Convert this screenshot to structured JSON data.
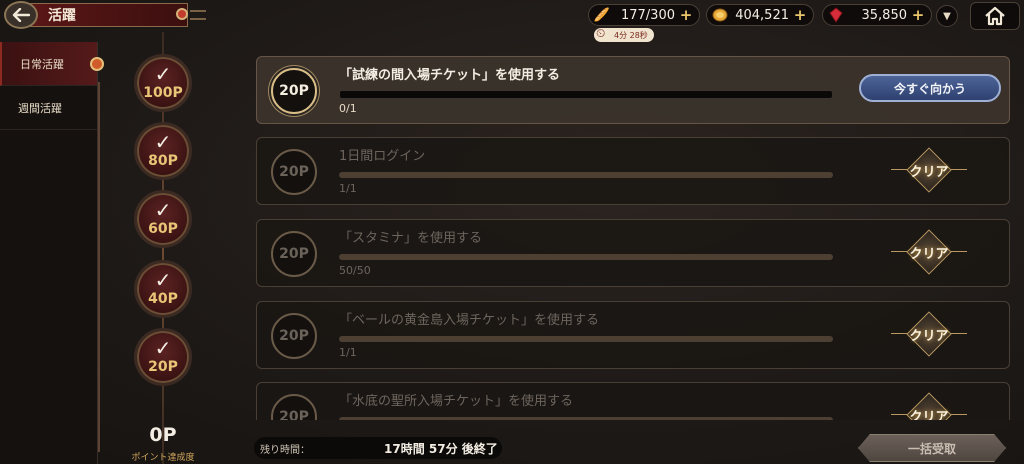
{
  "header": {
    "title": "活躍",
    "stamina": "177/300",
    "stamina_timer": "4分 28秒",
    "gold": "404,521",
    "gems": "35,850"
  },
  "sidebar": {
    "items": [
      {
        "label": "日常活躍"
      },
      {
        "label": "週間活躍"
      }
    ]
  },
  "milestones": {
    "items": [
      {
        "label": "100P"
      },
      {
        "label": "80P"
      },
      {
        "label": "60P"
      },
      {
        "label": "40P"
      },
      {
        "label": "20P"
      }
    ],
    "total": "0P",
    "total_label": "ポイント達成度"
  },
  "tasks": [
    {
      "points": "20P",
      "title": "「試練の間入場チケット」を使用する",
      "progress": "0/1",
      "action": "今すぐ向かう",
      "progress_fraction": 0
    },
    {
      "points": "20P",
      "title": "1日間ログイン",
      "progress": "1/1",
      "action": "クリア",
      "progress_fraction": 1
    },
    {
      "points": "20P",
      "title": "「スタミナ」を使用する",
      "progress": "50/50",
      "action": "クリア",
      "progress_fraction": 1
    },
    {
      "points": "20P",
      "title": "「ベールの黄金島入場チケット」を使用する",
      "progress": "1/1",
      "action": "クリア",
      "progress_fraction": 1
    },
    {
      "points": "20P",
      "title": "「水底の聖所入場チケット」を使用する",
      "progress": "",
      "action": "クリア",
      "progress_fraction": 1
    }
  ],
  "footer": {
    "remaining_label": "残り時間：",
    "remaining_value": "17時間 57分 後終了",
    "claim_all": "一括受取"
  }
}
